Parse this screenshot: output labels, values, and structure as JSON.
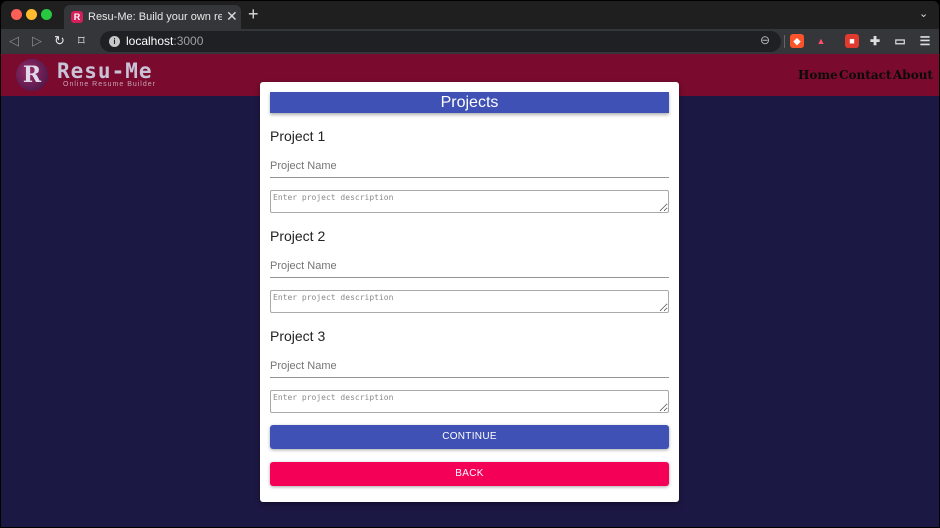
{
  "browser": {
    "tab_title": "Resu-Me: Build your own resume",
    "tab_favicon_letter": "R",
    "new_tab": "+",
    "close_tab": "✕",
    "url_host": "localhost",
    "url_port": ":3000",
    "icons": [
      "back-icon",
      "forward-icon",
      "reload-icon",
      "bookmark-icon",
      "site-info-icon",
      "zoom-icon",
      "brave-shield-icon",
      "brave-rewards-icon",
      "extension-red-icon",
      "puzzle-extensions-icon",
      "wallet-icon",
      "menu-icon"
    ]
  },
  "appbar": {
    "logo_letter": "R",
    "logo_title": "Resu-Me",
    "logo_subtitle": "Online Resume Builder",
    "nav": [
      "Home",
      "Contact",
      "About"
    ],
    "bg_color": "#7a0b2f"
  },
  "form": {
    "title": "Projects",
    "projects": [
      {
        "heading": "Project 1",
        "name_placeholder": "Project Name",
        "desc_placeholder": "Enter project description"
      },
      {
        "heading": "Project 2",
        "name_placeholder": "Project Name",
        "desc_placeholder": "Enter project description"
      },
      {
        "heading": "Project 3",
        "name_placeholder": "Project Name",
        "desc_placeholder": "Enter project description"
      }
    ],
    "continue_label": "CONTINUE",
    "back_label": "BACK",
    "primary_color": "#3f51b5",
    "secondary_color": "#f50057"
  },
  "page_bg": "#1c1844"
}
